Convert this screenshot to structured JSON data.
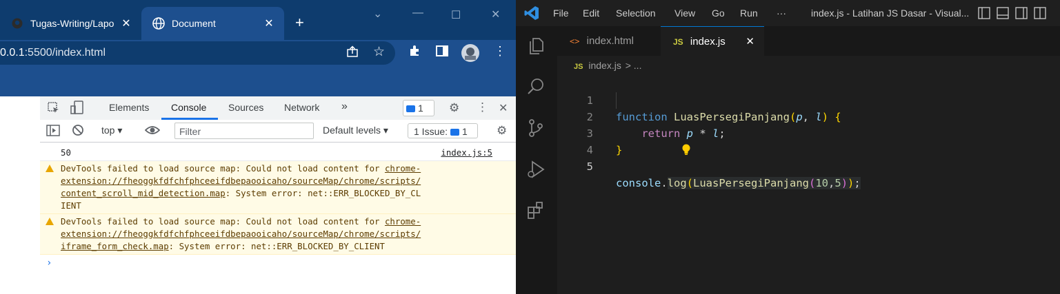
{
  "browser": {
    "tabs": [
      {
        "title": "Tugas-Writing/Lapo",
        "close": "✕"
      },
      {
        "title": "Document",
        "close": "✕"
      }
    ],
    "new_tab": "+",
    "url_host": "0.0.1",
    "url_rest": ":5500/index.html"
  },
  "devtools": {
    "tabs": [
      "Elements",
      "Console",
      "Sources",
      "Network",
      "»"
    ],
    "message_count": "1",
    "context": "top ▾",
    "filter_placeholder": "Filter",
    "levels": "Default levels ▾",
    "issues_label": "1 Issue:",
    "issues_count": "1",
    "console": {
      "log_value": "50",
      "log_source": "index.js:5",
      "warnings": [
        {
          "prefix": "DevTools failed to load source map: Could not load content for ",
          "link": "chrome-extension://fheoggkfdfchfphceeifdbepaooicaho/sourceMap/chrome/scripts/content_scroll_mid_detection.map",
          "suffix": ": System error: net::ERR_BLOCKED_BY_CLIENT"
        },
        {
          "prefix": "DevTools failed to load source map: Could not load content for ",
          "link": "chrome-extension://fheoggkfdfchfphceeifdbepaooicaho/sourceMap/chrome/scripts/iframe_form_check.map",
          "suffix": ": System error: net::ERR_BLOCKED_BY_CLIENT"
        }
      ],
      "prompt": "›"
    }
  },
  "vscode": {
    "menu": [
      "File",
      "Edit",
      "Selection",
      "View",
      "Go",
      "Run",
      "···"
    ],
    "title": "index.js - Latihan JS Dasar - Visual...",
    "tabs": [
      {
        "label": "index.html",
        "icon": "<>"
      },
      {
        "label": "index.js",
        "icon": "JS",
        "close": "✕"
      }
    ],
    "breadcrumb": {
      "icon": "JS",
      "file": "index.js",
      "more": "> ..."
    },
    "line_numbers": [
      "1",
      "2",
      "3",
      "4",
      "5"
    ],
    "code": {
      "l1_kw": "function",
      "l1_name": "LuasPersegiPanjang",
      "l1_p": "p",
      "l1_l": "l",
      "l2_kw": "return",
      "l2_p": "p",
      "l2_op": "*",
      "l2_l": "l",
      "l5_obj": "console",
      "l5_method": "log",
      "l5_fn": "LuasPersegiPanjang",
      "l5_a": "10",
      "l5_b": "5"
    }
  }
}
